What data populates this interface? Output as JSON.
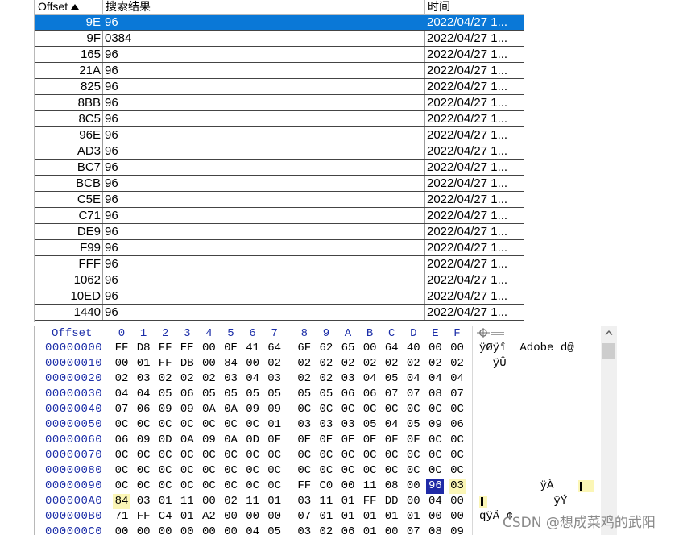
{
  "results": {
    "columns": [
      "Offset",
      "搜索结果",
      "时间"
    ],
    "sort_indicator": "sort-up-icon",
    "selected_index": 0,
    "rows": [
      {
        "offset": "9E",
        "result": "96",
        "time": "2022/04/27  1..."
      },
      {
        "offset": "9F",
        "result": "0384",
        "time": "2022/04/27  1..."
      },
      {
        "offset": "165",
        "result": "96",
        "time": "2022/04/27  1..."
      },
      {
        "offset": "21A",
        "result": "96",
        "time": "2022/04/27  1..."
      },
      {
        "offset": "825",
        "result": "96",
        "time": "2022/04/27  1..."
      },
      {
        "offset": "8BB",
        "result": "96",
        "time": "2022/04/27  1..."
      },
      {
        "offset": "8C5",
        "result": "96",
        "time": "2022/04/27  1..."
      },
      {
        "offset": "96E",
        "result": "96",
        "time": "2022/04/27  1..."
      },
      {
        "offset": "AD3",
        "result": "96",
        "time": "2022/04/27  1..."
      },
      {
        "offset": "BC7",
        "result": "96",
        "time": "2022/04/27  1..."
      },
      {
        "offset": "BCB",
        "result": "96",
        "time": "2022/04/27  1..."
      },
      {
        "offset": "C5E",
        "result": "96",
        "time": "2022/04/27  1..."
      },
      {
        "offset": "C71",
        "result": "96",
        "time": "2022/04/27  1..."
      },
      {
        "offset": "DE9",
        "result": "96",
        "time": "2022/04/27  1..."
      },
      {
        "offset": "F99",
        "result": "96",
        "time": "2022/04/27  1..."
      },
      {
        "offset": "FFF",
        "result": "96",
        "time": "2022/04/27  1..."
      },
      {
        "offset": "1062",
        "result": "96",
        "time": "2022/04/27  1..."
      },
      {
        "offset": "10ED",
        "result": "96",
        "time": "2022/04/27  1..."
      },
      {
        "offset": "1440",
        "result": "96",
        "time": "2022/04/27  1..."
      }
    ]
  },
  "hex": {
    "offset_header": "Offset",
    "column_headers": [
      "0",
      "1",
      "2",
      "3",
      "4",
      "5",
      "6",
      "7",
      "8",
      "9",
      "A",
      "B",
      "C",
      "D",
      "E",
      "F"
    ],
    "highlight_dark": [
      "9E"
    ],
    "highlight_light": [
      "9F",
      "A0"
    ],
    "lines": [
      {
        "addr": "00000000",
        "bytes": [
          "FF",
          "D8",
          "FF",
          "EE",
          "00",
          "0E",
          "41",
          "64",
          "6F",
          "62",
          "65",
          "00",
          "64",
          "40",
          "00",
          "00"
        ],
        "ascii": "ÿØÿî  Adobe d@"
      },
      {
        "addr": "00000010",
        "bytes": [
          "00",
          "01",
          "FF",
          "DB",
          "00",
          "84",
          "00",
          "02",
          "02",
          "02",
          "02",
          "02",
          "02",
          "02",
          "02",
          "02"
        ],
        "ascii": "  ÿÛ "
      },
      {
        "addr": "00000020",
        "bytes": [
          "02",
          "03",
          "02",
          "02",
          "02",
          "03",
          "04",
          "03",
          "02",
          "02",
          "03",
          "04",
          "05",
          "04",
          "04",
          "04"
        ],
        "ascii": ""
      },
      {
        "addr": "00000030",
        "bytes": [
          "04",
          "04",
          "05",
          "06",
          "05",
          "05",
          "05",
          "05",
          "05",
          "05",
          "06",
          "06",
          "07",
          "07",
          "08",
          "07"
        ],
        "ascii": ""
      },
      {
        "addr": "00000040",
        "bytes": [
          "07",
          "06",
          "09",
          "09",
          "0A",
          "0A",
          "09",
          "09",
          "0C",
          "0C",
          "0C",
          "0C",
          "0C",
          "0C",
          "0C",
          "0C"
        ],
        "ascii": ""
      },
      {
        "addr": "00000050",
        "bytes": [
          "0C",
          "0C",
          "0C",
          "0C",
          "0C",
          "0C",
          "0C",
          "01",
          "03",
          "03",
          "03",
          "05",
          "04",
          "05",
          "09",
          "06"
        ],
        "ascii": ""
      },
      {
        "addr": "00000060",
        "bytes": [
          "06",
          "09",
          "0D",
          "0A",
          "09",
          "0A",
          "0D",
          "0F",
          "0E",
          "0E",
          "0E",
          "0E",
          "0F",
          "0F",
          "0C",
          "0C"
        ],
        "ascii": ""
      },
      {
        "addr": "00000070",
        "bytes": [
          "0C",
          "0C",
          "0C",
          "0C",
          "0C",
          "0C",
          "0C",
          "0C",
          "0C",
          "0C",
          "0C",
          "0C",
          "0C",
          "0C",
          "0C",
          "0C"
        ],
        "ascii": ""
      },
      {
        "addr": "00000080",
        "bytes": [
          "0C",
          "0C",
          "0C",
          "0C",
          "0C",
          "0C",
          "0C",
          "0C",
          "0C",
          "0C",
          "0C",
          "0C",
          "0C",
          "0C",
          "0C",
          "0C"
        ],
        "ascii": ""
      },
      {
        "addr": "00000090",
        "bytes": [
          "0C",
          "0C",
          "0C",
          "0C",
          "0C",
          "0C",
          "0C",
          "0C",
          "FF",
          "C0",
          "00",
          "11",
          "08",
          "00",
          "96",
          "03"
        ],
        "ascii": "         ÿÀ"
      },
      {
        "addr": "000000A0",
        "bytes": [
          "84",
          "03",
          "01",
          "11",
          "00",
          "02",
          "11",
          "01",
          "03",
          "11",
          "01",
          "FF",
          "DD",
          "00",
          "04",
          "00"
        ],
        "ascii": "           ÿÝ"
      },
      {
        "addr": "000000B0",
        "bytes": [
          "71",
          "FF",
          "C4",
          "01",
          "A2",
          "00",
          "00",
          "00",
          "07",
          "01",
          "01",
          "01",
          "01",
          "01",
          "00",
          "00"
        ],
        "ascii": "qÿÄ ¢"
      },
      {
        "addr": "000000C0",
        "bytes": [
          "00",
          "00",
          "00",
          "00",
          "00",
          "00",
          "04",
          "05",
          "03",
          "02",
          "06",
          "01",
          "00",
          "07",
          "08",
          "09"
        ],
        "ascii": ""
      }
    ]
  },
  "watermark": "CSDN @想成菜鸡的武阳"
}
